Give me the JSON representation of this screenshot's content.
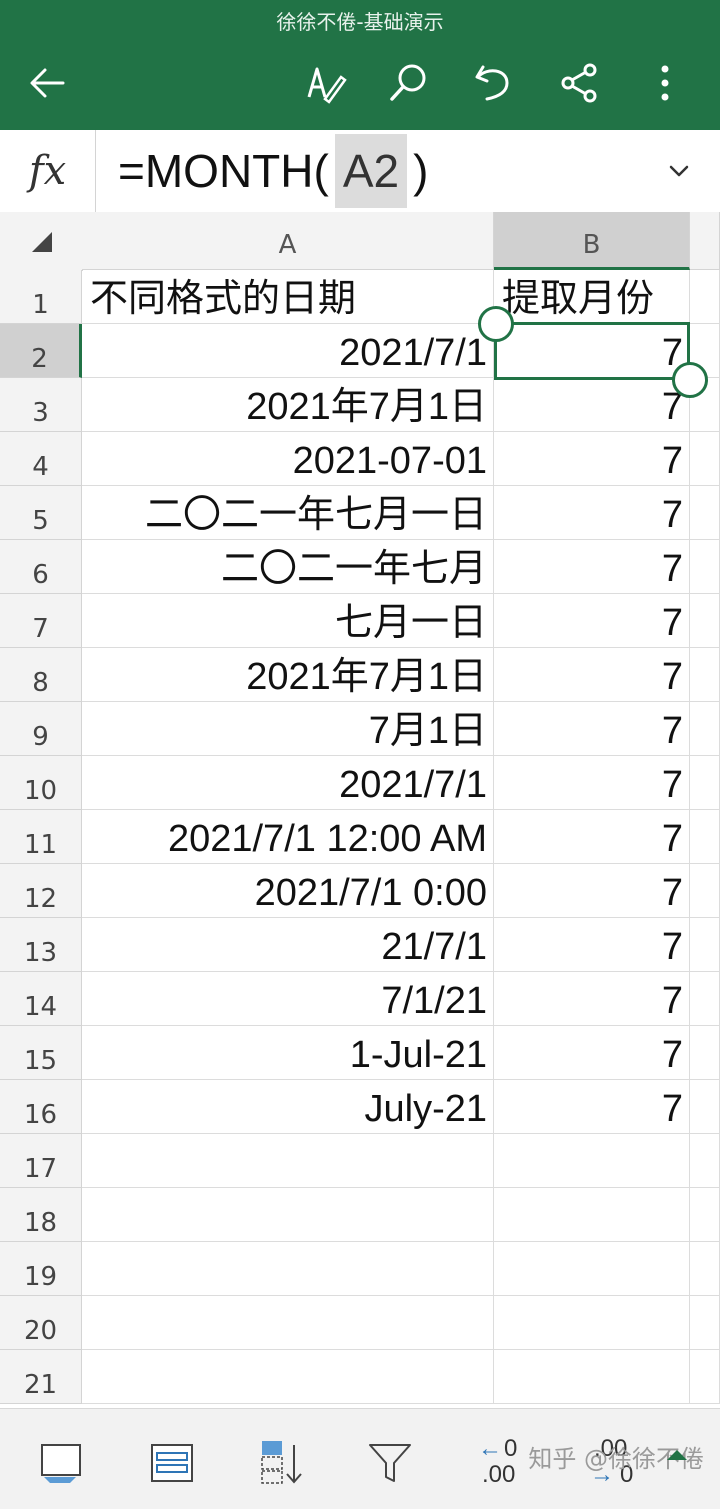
{
  "app": {
    "document_title": "徐徐不倦-基础演示",
    "accent_color": "#217346"
  },
  "toolbar": {
    "icons": [
      "back-arrow-icon",
      "draw-pen-icon",
      "search-icon",
      "undo-icon",
      "share-icon",
      "more-vert-icon"
    ]
  },
  "formula_bar": {
    "fx_label": "fx",
    "prefix": "=MONTH(",
    "reference": "A2",
    "suffix": ")"
  },
  "sheet": {
    "columns": [
      "A",
      "B"
    ],
    "selected_column": "B",
    "selected_row": "2",
    "rows": [
      {
        "num": "1",
        "a": "不同格式的日期",
        "b": "提取月份"
      },
      {
        "num": "2",
        "a": "2021/7/1",
        "b": "7"
      },
      {
        "num": "3",
        "a": "2021年7月1日",
        "b": "7"
      },
      {
        "num": "4",
        "a": "2021-07-01",
        "b": "7"
      },
      {
        "num": "5",
        "a": "二〇二一年七月一日",
        "b": "7"
      },
      {
        "num": "6",
        "a": "二〇二一年七月",
        "b": "7"
      },
      {
        "num": "7",
        "a": "七月一日",
        "b": "7"
      },
      {
        "num": "8",
        "a": "2021年7月1日",
        "b": "7"
      },
      {
        "num": "9",
        "a": "7月1日",
        "b": "7"
      },
      {
        "num": "10",
        "a": "2021/7/1",
        "b": "7"
      },
      {
        "num": "11",
        "a": "2021/7/1 12:00 AM",
        "b": "7"
      },
      {
        "num": "12",
        "a": "2021/7/1 0:00",
        "b": "7"
      },
      {
        "num": "13",
        "a": "21/7/1",
        "b": "7"
      },
      {
        "num": "14",
        "a": "7/1/21",
        "b": "7"
      },
      {
        "num": "15",
        "a": "1-Jul-21",
        "b": "7"
      },
      {
        "num": "16",
        "a": "July-21",
        "b": "7"
      },
      {
        "num": "17",
        "a": "",
        "b": ""
      },
      {
        "num": "18",
        "a": "",
        "b": ""
      },
      {
        "num": "19",
        "a": "",
        "b": ""
      },
      {
        "num": "20",
        "a": "",
        "b": ""
      },
      {
        "num": "21",
        "a": "",
        "b": ""
      }
    ]
  },
  "bottom_bar": {
    "icons": [
      "borders-icon",
      "wrap-text-icon",
      "sort-icon",
      "filter-icon",
      "decrease-decimal-icon",
      "increase-decimal-icon",
      "expand-up-icon"
    ],
    "decrease_decimal_top": "0",
    "decrease_decimal_bottom": ".00",
    "increase_decimal_top": ".00",
    "increase_decimal_bottom": "0",
    "watermark": "知乎 @徐徐不倦"
  }
}
